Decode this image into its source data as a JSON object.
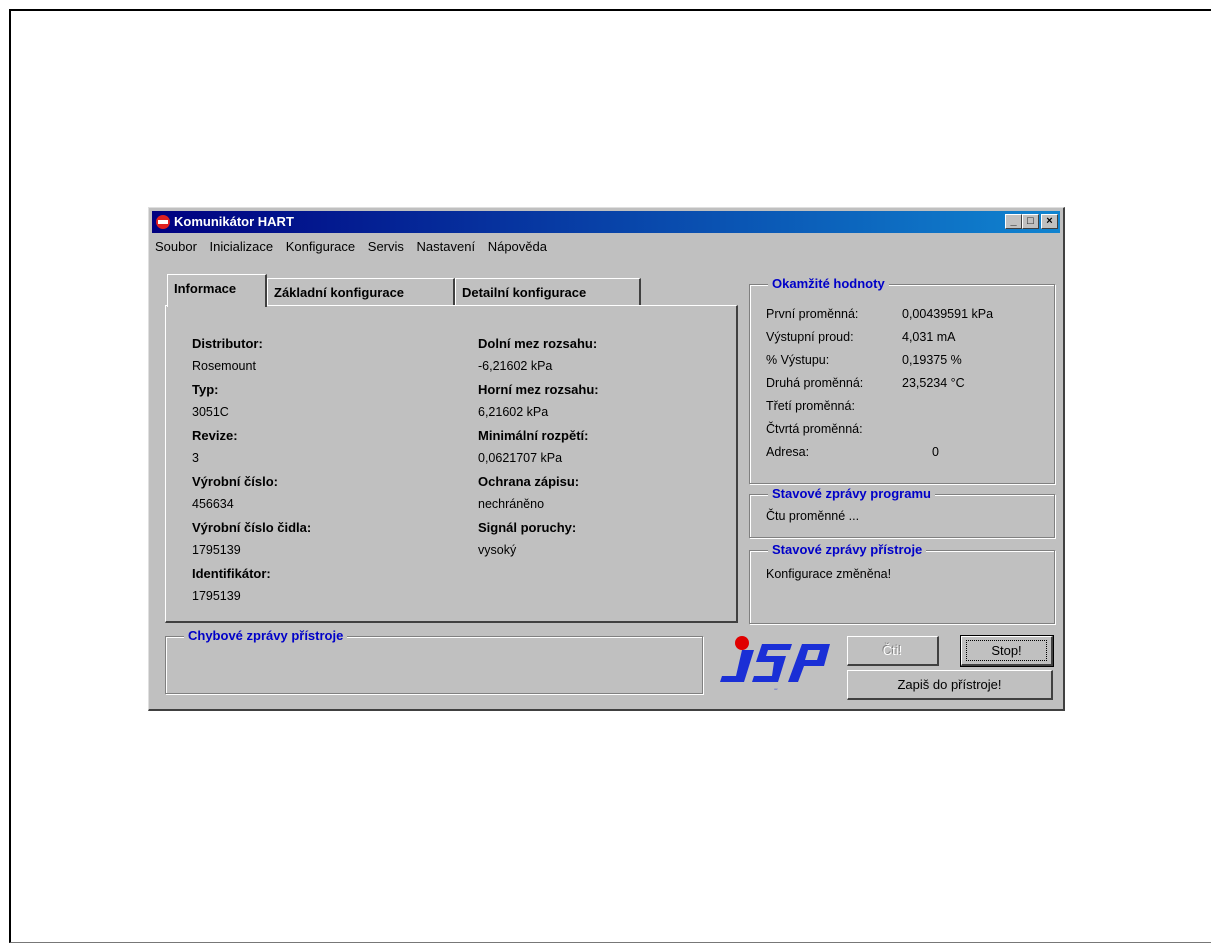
{
  "window": {
    "title": "Komunikátor HART",
    "minimize_glyph": "_",
    "maximize_glyph": "□",
    "close_glyph": "×"
  },
  "menu": [
    "Soubor",
    "Inicializace",
    "Konfigurace",
    "Servis",
    "Nastavení",
    "Nápověda"
  ],
  "tabs": [
    "Informace",
    "Základní konfigurace",
    "Detailní konfigurace"
  ],
  "info": {
    "left": [
      {
        "label": "Distributor:",
        "value": "Rosemount"
      },
      {
        "label": "Typ:",
        "value": "3051C"
      },
      {
        "label": "Revize:",
        "value": "3"
      },
      {
        "label": "Výrobní číslo:",
        "value": "456634"
      },
      {
        "label": "Výrobní číslo čidla:",
        "value": "1795139"
      },
      {
        "label": "Identifikátor:",
        "value": "1795139"
      }
    ],
    "right": [
      {
        "label": "Dolní mez rozsahu:",
        "value": "-6,21602 kPa"
      },
      {
        "label": "Horní mez rozsahu:",
        "value": "6,21602 kPa"
      },
      {
        "label": "Minimální rozpětí:",
        "value": "0,0621707 kPa"
      },
      {
        "label": "Ochrana zápisu:",
        "value": "nechráněno"
      },
      {
        "label": "Signál poruchy:",
        "value": "vysoký"
      }
    ]
  },
  "okamzite": {
    "title": "Okamžité hodnoty",
    "rows": [
      {
        "label": "První proměnná:",
        "value": "0,00439591 kPa"
      },
      {
        "label": "Výstupní proud:",
        "value": "4,031 mA"
      },
      {
        "label": "% Výstupu:",
        "value": "0,19375 %"
      },
      {
        "label": "Druhá proměnná:",
        "value": "23,5234 °C"
      },
      {
        "label": "Třetí proměnná:",
        "value": ""
      },
      {
        "label": "Čtvrtá proměnná:",
        "value": ""
      },
      {
        "label": "Adresa:",
        "value": "0"
      }
    ]
  },
  "program_status": {
    "title": "Stavové zprávy programu",
    "text": "Čtu proměnné ..."
  },
  "device_status": {
    "title": "Stavové zprávy přístroje",
    "text": "Konfigurace změněna!"
  },
  "errors": {
    "title": "Chybové zprávy přístroje"
  },
  "buttons": {
    "read": "Čti!",
    "stop": "Stop!",
    "write": "Zapiš do přístroje!"
  },
  "logo": {
    "text": "JSP",
    "colors": {
      "blue": "#1a2fd6",
      "red": "#e00000"
    }
  }
}
